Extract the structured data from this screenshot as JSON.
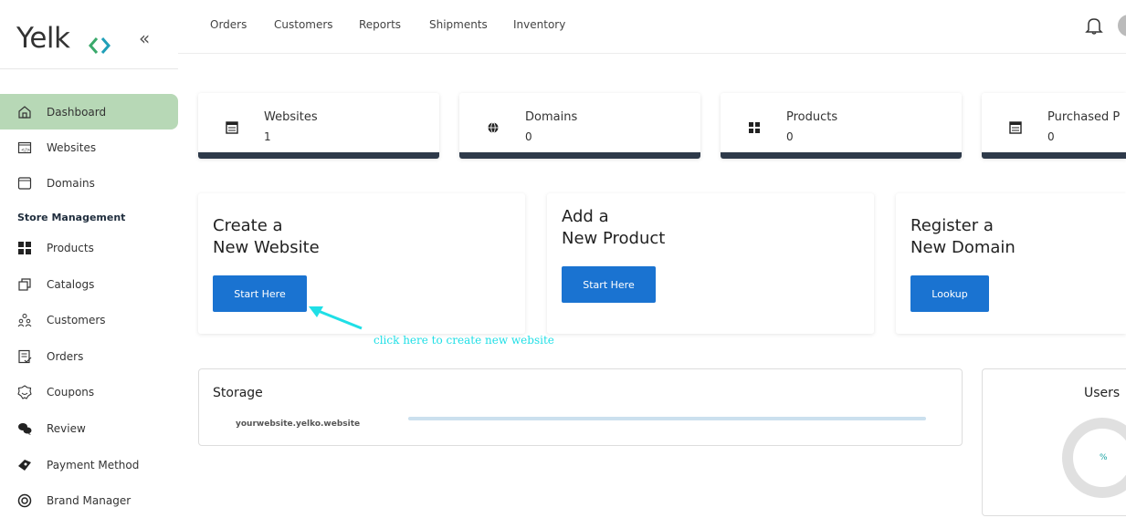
{
  "brand": {
    "name": "Yelk"
  },
  "sidebar": {
    "items": [
      {
        "label": "Dashboard",
        "icon": "home-icon"
      },
      {
        "label": "Websites",
        "icon": "code-window-icon"
      },
      {
        "label": "Domains",
        "icon": "browser-window-icon"
      }
    ],
    "section_title": "Store Management",
    "store_items": [
      {
        "label": "Products",
        "icon": "grid-icon"
      },
      {
        "label": "Catalogs",
        "icon": "copy-icon"
      },
      {
        "label": "Customers",
        "icon": "users-icon"
      },
      {
        "label": "Orders",
        "icon": "order-list-icon"
      },
      {
        "label": "Coupons",
        "icon": "coupon-icon"
      },
      {
        "label": "Review",
        "icon": "chat-icon"
      },
      {
        "label": "Payment Method",
        "icon": "payment-icon"
      },
      {
        "label": "Brand Manager",
        "icon": "target-icon"
      }
    ]
  },
  "topnav": {
    "links": [
      "Orders",
      "Customers",
      "Reports",
      "Shipments",
      "Inventory"
    ]
  },
  "stats": [
    {
      "title": "Websites",
      "value": "1"
    },
    {
      "title": "Domains",
      "value": "0"
    },
    {
      "title": "Products",
      "value": "0"
    },
    {
      "title": "Purchased P",
      "value": "0"
    }
  ],
  "actions": [
    {
      "line1": "Create a",
      "line2": "New Website",
      "button": "Start Here"
    },
    {
      "line1": "Add a",
      "line2": "New Product",
      "button": "Start Here"
    },
    {
      "line1": "Register a",
      "line2": "New Domain",
      "button": "Lookup"
    }
  ],
  "annotation": "click here to create new website",
  "storage": {
    "title": "Storage",
    "site": "yourwebsite.yelko.website"
  },
  "users": {
    "title": "Users",
    "percent": "%"
  },
  "colors": {
    "accent": "#1a73d1",
    "active_nav": "#b7d8b6",
    "stat_bar": "#2e3a4a",
    "annotation": "#1fdfe6",
    "logo_green": "#3aa96b",
    "logo_teal": "#1f9fb8"
  }
}
